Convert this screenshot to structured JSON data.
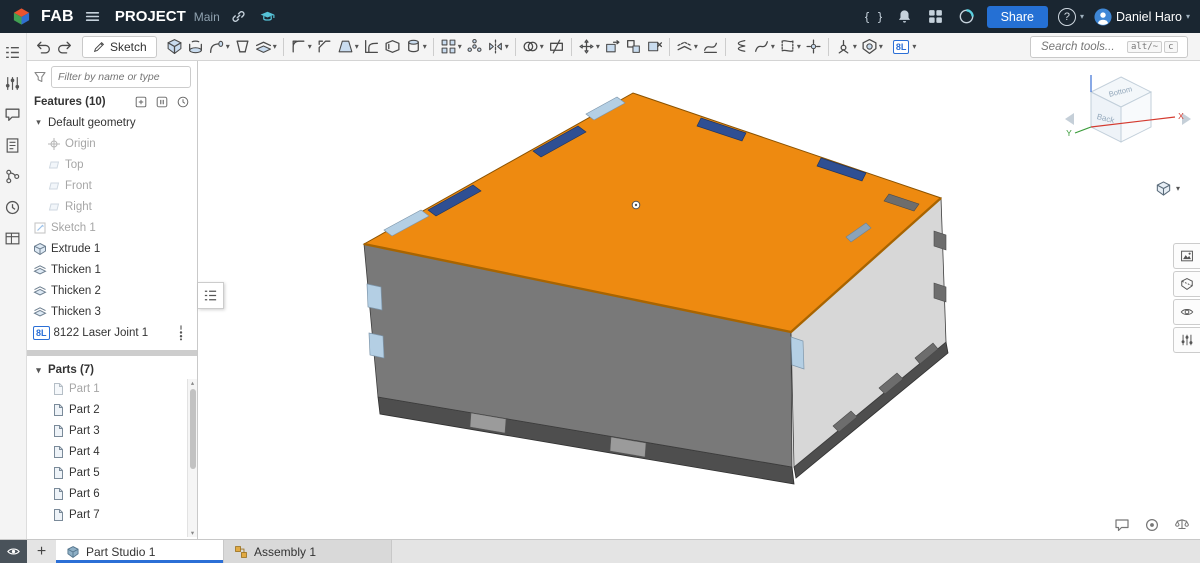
{
  "topbar": {
    "logo_text": "FAB",
    "title": "PROJECT",
    "workspace": "Main",
    "share_label": "Share",
    "user_name": "Daniel Haro",
    "right_icons": [
      {
        "name": "featurescript-icon",
        "glyph": "fs"
      },
      {
        "name": "notifications-icon",
        "glyph": "bell"
      },
      {
        "name": "app-store-icon",
        "glyph": "grid"
      },
      {
        "name": "learning-center-icon",
        "glyph": "learn"
      }
    ]
  },
  "toolbar": {
    "sketch_label": "Sketch",
    "custom_tool_label": "8L",
    "search_placeholder": "Search tools...",
    "shortcut_keys": [
      "alt/~",
      "c"
    ],
    "left_items": [
      {
        "name": "undo-button",
        "shape": "undo"
      },
      {
        "name": "redo-button",
        "shape": "redo"
      }
    ],
    "items": [
      {
        "name": "extrude-tool-button",
        "shape": "cube"
      },
      {
        "name": "revolve-tool-button",
        "shape": "revolve"
      },
      {
        "name": "sweep-tool-button",
        "shape": "sweep",
        "caret": true
      },
      {
        "name": "loft-tool-button",
        "shape": "loft"
      },
      {
        "name": "thicken-tool-button",
        "shape": "thicken",
        "caret": true
      },
      {
        "sep": true
      },
      {
        "name": "fillet-tool-button",
        "shape": "fillet",
        "caret": true
      },
      {
        "name": "chamfer-tool-button",
        "shape": "chamfer"
      },
      {
        "name": "draft-tool-button",
        "shape": "draft",
        "caret": true
      },
      {
        "name": "rib-tool-button",
        "shape": "rib"
      },
      {
        "name": "shell-tool-button",
        "shape": "shell"
      },
      {
        "name": "hole-tool-button",
        "shape": "hole",
        "caret": true
      },
      {
        "sep": true
      },
      {
        "name": "linear-pattern-tool-button",
        "shape": "grid",
        "caret": true
      },
      {
        "name": "circular-pattern-tool-button",
        "shape": "radial"
      },
      {
        "name": "mirror-tool-button",
        "shape": "mirror",
        "caret": true
      },
      {
        "sep": true
      },
      {
        "name": "boolean-tool-button",
        "shape": "boolean",
        "caret": true
      },
      {
        "name": "split-tool-button",
        "shape": "split"
      },
      {
        "sep": true
      },
      {
        "name": "transform-tool-button",
        "shape": "move",
        "caret": true
      },
      {
        "name": "move-face-tool-button",
        "shape": "moveface"
      },
      {
        "name": "replace-face-tool-button",
        "shape": "replace"
      },
      {
        "name": "delete-face-tool-button",
        "shape": "delface"
      },
      {
        "sep": true
      },
      {
        "name": "offset-surface-tool-button",
        "shape": "offset",
        "caret": true
      },
      {
        "name": "fill-surface-tool-button",
        "shape": "fillsurf"
      },
      {
        "sep": true
      },
      {
        "name": "helix-tool-button",
        "shape": "helix"
      },
      {
        "name": "spline-tool-button",
        "shape": "curve",
        "caret": true
      },
      {
        "name": "projected-curve-tool-button",
        "shape": "proj",
        "caret": true
      },
      {
        "name": "point-tool-button",
        "shape": "point"
      },
      {
        "sep": true
      },
      {
        "name": "mate-connector-tool-button",
        "shape": "mate",
        "caret": true
      },
      {
        "name": "composite-part-tool-button",
        "shape": "comp",
        "caret": true
      }
    ]
  },
  "left_strip": {
    "items": [
      {
        "name": "feature-list-toggle",
        "glyph": "list"
      },
      {
        "name": "configurations-button",
        "glyph": "config"
      },
      {
        "name": "comments-panel-button",
        "glyph": "comment"
      },
      {
        "name": "notes-panel-button",
        "glyph": "note"
      },
      {
        "name": "versions-button",
        "glyph": "versions"
      },
      {
        "name": "history-button",
        "glyph": "history"
      },
      {
        "name": "tables-panel-button",
        "glyph": "tables"
      }
    ]
  },
  "panel": {
    "filter_placeholder": "Filter by name or type",
    "features_header": "Features (10)",
    "header_icons": [
      {
        "name": "insert-feature-button",
        "glyph": "insert"
      },
      {
        "name": "suspend-rebuild-button",
        "glyph": "suspend"
      },
      {
        "name": "rollback-end-button",
        "glyph": "clock"
      }
    ],
    "tree": [
      {
        "label": "Default geometry",
        "level": 0,
        "chevron": true
      },
      {
        "label": "Origin",
        "level": 1,
        "icon": "origin",
        "muted": true
      },
      {
        "label": "Top",
        "level": 1,
        "icon": "plane",
        "muted": true
      },
      {
        "label": "Front",
        "level": 1,
        "icon": "plane",
        "muted": true
      },
      {
        "label": "Right",
        "level": 1,
        "icon": "plane",
        "muted": true
      },
      {
        "label": "Sketch 1",
        "level": 0,
        "icon": "sketch",
        "muted": true
      },
      {
        "label": "Extrude 1",
        "level": 0,
        "icon": "extrude"
      },
      {
        "label": "Thicken 1",
        "level": 0,
        "icon": "thicken"
      },
      {
        "label": "Thicken 2",
        "level": 0,
        "icon": "thicken"
      },
      {
        "label": "Thicken 3",
        "level": 0,
        "icon": "thicken"
      },
      {
        "label": "8122 Laser Joint 1",
        "level": 0,
        "badge": "8L",
        "marker": true
      }
    ],
    "parts_header": "Parts (7)",
    "parts": [
      {
        "label": "Part 1",
        "muted": true
      },
      {
        "label": "Part 2"
      },
      {
        "label": "Part 3"
      },
      {
        "label": "Part 4"
      },
      {
        "label": "Part 5"
      },
      {
        "label": "Part 6"
      },
      {
        "label": "Part 7"
      }
    ]
  },
  "viewport": {
    "view_cube": {
      "top_label": "Bottom",
      "side_label": "Back",
      "axis_x": "X",
      "axis_y": "Y"
    },
    "right_tools": [
      {
        "name": "appearance-panel-button",
        "glyph": "appearance"
      },
      {
        "name": "section-view-button",
        "glyph": "section"
      },
      {
        "name": "named-views-button",
        "glyph": "views"
      },
      {
        "name": "configurations-panel-button",
        "glyph": "config"
      }
    ],
    "bottom_tools": [
      {
        "name": "viewport-comments-button",
        "glyph": "comment"
      },
      {
        "name": "presence-button",
        "glyph": "presence"
      },
      {
        "name": "units-measure-button",
        "glyph": "measure"
      }
    ]
  },
  "bottom_bar": {
    "tabs": [
      {
        "label": "Part Studio 1",
        "active": true,
        "icon": "partstudio"
      },
      {
        "label": "Assembly 1",
        "active": false,
        "icon": "assembly"
      }
    ]
  },
  "colors": {
    "accent": "#2b6fd6",
    "topbar_bg": "#1a2631",
    "share_blue": "#2570d4",
    "box_top": "#ee8a10",
    "box_top_edge": "#a86400",
    "box_front": "#797979",
    "box_right": "#d7d7d7",
    "box_bottom": "#4e4e4e",
    "tab_navy": "#2f4f93",
    "tab_light_blue": "#b4cfe4",
    "finger_light": "#9b9b9b",
    "slot_dark": "#6d6d6d",
    "slot_blue_gray": "#8ba3b8"
  }
}
